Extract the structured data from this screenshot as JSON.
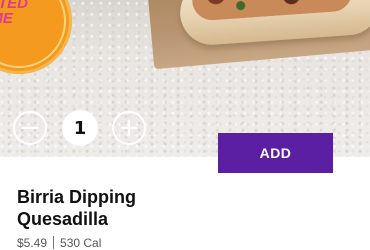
{
  "badge": {
    "line1": "LIMITED",
    "line2": "TIME"
  },
  "quantity": {
    "value": "1",
    "decrement_symbol": "−",
    "increment_symbol": "+"
  },
  "add_label": "ADD",
  "product": {
    "name_line1": "Birria Dipping",
    "name_line2": "Quesadilla",
    "price": "$5.49",
    "calories": "530 Cal"
  },
  "colors": {
    "accent": "#5b1fa4",
    "badge": "#f39a1f",
    "badge_text": "#e23a8f"
  }
}
